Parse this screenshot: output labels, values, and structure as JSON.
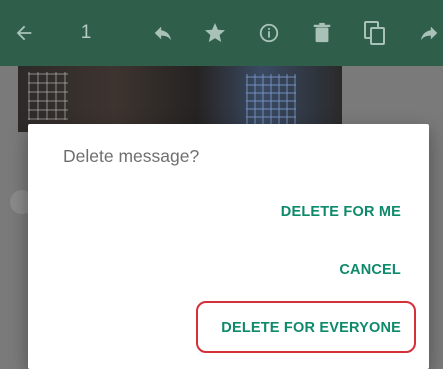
{
  "toolbar": {
    "selected_count": "1",
    "icons": [
      "back-arrow-icon",
      "reply-icon",
      "star-icon",
      "info-icon",
      "delete-icon",
      "copy-icon",
      "forward-icon"
    ]
  },
  "dialog": {
    "title": "Delete message?",
    "delete_for_me": "DELETE FOR ME",
    "cancel": "CANCEL",
    "delete_for_everyone": "DELETE FOR EVERYONE"
  },
  "colors": {
    "toolbar": "#2f5e4b",
    "accent": "#0d8a6b",
    "highlight": "#d4303a"
  }
}
